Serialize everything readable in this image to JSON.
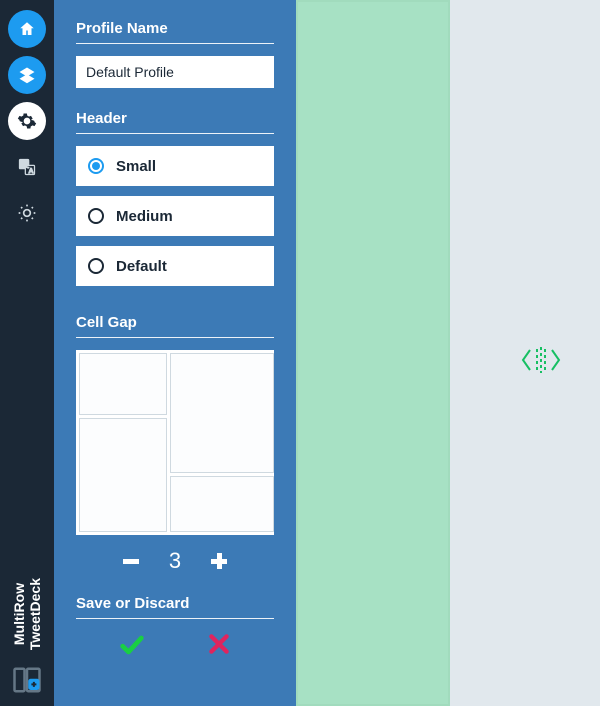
{
  "brand": {
    "line1": "MultiRow",
    "line2": "TweetDeck"
  },
  "nav": {
    "home": "home-icon",
    "layers": "layers-icon",
    "settings": "gear-icon",
    "translate": "translate-icon",
    "brightness": "brightness-icon",
    "bottom": "layout-add-icon"
  },
  "profile": {
    "title": "Profile Name",
    "value": "Default Profile"
  },
  "header": {
    "title": "Header",
    "options": [
      "Small",
      "Medium",
      "Default"
    ],
    "selected": "Small"
  },
  "cellgap": {
    "title": "Cell Gap",
    "value": "3"
  },
  "save": {
    "title": "Save or Discard"
  }
}
